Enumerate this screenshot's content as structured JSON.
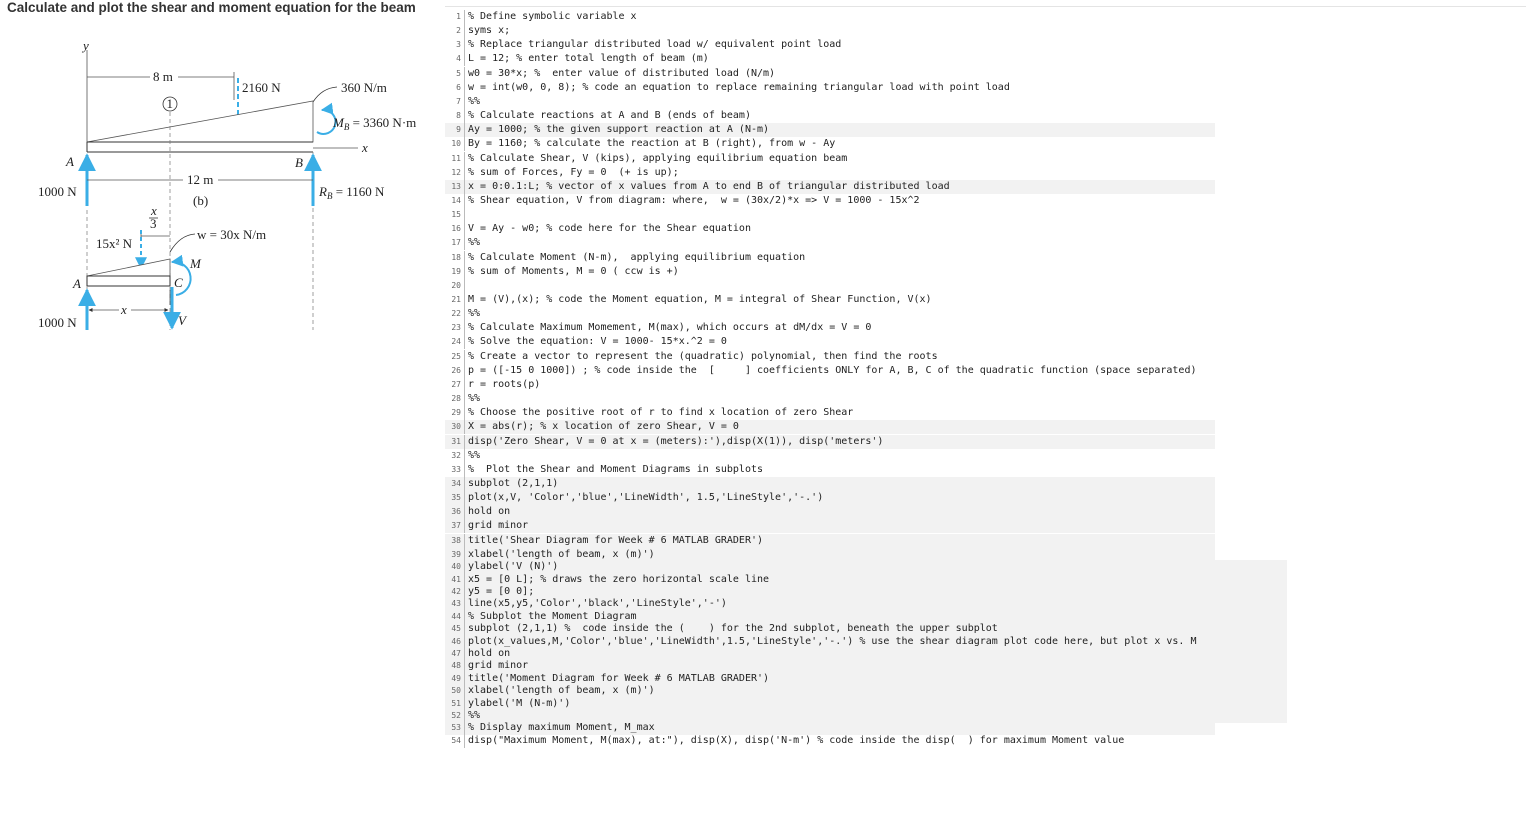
{
  "title": "Calculate and plot the shear and moment equation for the beam",
  "diagram": {
    "y_axis": "y",
    "x_axis": "x",
    "len_8m": "8 m",
    "len_12m": "12 m",
    "load_2160": "2160 N",
    "load_360": "360 N/m",
    "circle_1": "1",
    "moment_b": "M",
    "moment_b_sub": "B",
    "moment_b_val": " = 3360 N·m",
    "point_a": "A",
    "point_b": "B",
    "reaction_1000": "1000 N",
    "reaction_b": "R",
    "reaction_b_sub": "B",
    "reaction_b_val": " = 1160 N",
    "fig_b": "(b)",
    "frac_num": "x",
    "frac_den": "3",
    "w_label": "w = 30x N/m",
    "load_15x2": "15x² N",
    "m_label": "M",
    "c_label": "C",
    "v_label": "V",
    "point_a2": "A",
    "x_dim": "x",
    "reaction_1000b": "1000 N"
  },
  "code_lines": [
    "% Define symbolic variable x",
    "syms x;",
    "% Replace triangular distributed load w/ equivalent point load",
    "L = 12; % enter total length of beam (m)",
    "w0 = 30*x; %  enter value of distributed load (N/m)",
    "w = int(w0, 0, 8); % code an equation to replace remaining triangular load with point load",
    "%%",
    "% Calculate reactions at A and B (ends of beam)",
    "Ay = 1000; % the given support reaction at A (N-m)",
    "By = 1160; % calculate the reaction at B (right), from w - Ay",
    "% Calculate Shear, V (kips), applying equilibrium equation beam",
    "% sum of Forces, Fy = 0  (+ is up);",
    "x = 0:0.1:L; % vector of x values from A to end B of triangular distributed load",
    "% Shear equation, V from diagram: where,  w = (30x/2)*x => V = 1000 - 15x^2",
    "",
    "V = Ay - w0; % code here for the Shear equation",
    "%%",
    "% Calculate Moment (N-m),  applying equilibrium equation",
    "% sum of Moments, M = 0 ( ccw is +)",
    "",
    "M = (V),(x); % code the Moment equation, M = integral of Shear Function, V(x)",
    "%%",
    "% Calculate Maximum Momement, M(max), which occurs at dM/dx = V = 0",
    "% Solve the equation: V = 1000- 15*x.^2 = 0",
    "% Create a vector to represent the (quadratic) polynomial, then find the roots",
    "p = ([-15 0 1000]) ; % code inside the  [     ] coefficients ONLY for A, B, C of the quadratic function (space separated)",
    "r = roots(p)",
    "%%",
    "% Choose the positive root of r to find x location of zero Shear",
    "X = abs(r); % x location of zero Shear, V = 0",
    "disp('Zero Shear, V = 0 at x = (meters):'),disp(X(1)), disp('meters')",
    "%%",
    "%  Plot the Shear and Moment Diagrams in subplots",
    "subplot (2,1,1)",
    "plot(x,V, 'Color','blue','LineWidth', 1.5,'LineStyle','-.')",
    "hold on",
    "grid minor",
    "title('Shear Diagram for Week # 6 MATLAB GRADER')",
    "xlabel('length of beam, x (m)')",
    "ylabel('V (N)')",
    "x5 = [0 L]; % draws the zero horizontal scale line",
    "y5 = [0 0];",
    "line(x5,y5,'Color','black','LineStyle','-')",
    "% Subplot the Moment Diagram",
    "subplot (2,1,1) %  code inside the (    ) for the 2nd subplot, beneath the upper subplot",
    "plot(x_values,M,'Color','blue','LineWidth',1.5,'LineStyle','-.') % use the shear diagram plot code here, but plot x vs. M",
    "hold on",
    "grid minor",
    "title('Moment Diagram for Week # 6 MATLAB GRADER')",
    "xlabel('length of beam, x (m)')",
    "ylabel('M (N-m)')",
    "%%",
    "% Display maximum Moment, M_max",
    "disp(\"Maximum Moment, M(max), at:\"), disp(X), disp('N-m') % code inside the disp(  ) for maximum Moment value"
  ],
  "colors": {
    "accent_blue": "#3aaee6",
    "string_purple": "#a02ab0",
    "shade": "#f2f2f2"
  }
}
